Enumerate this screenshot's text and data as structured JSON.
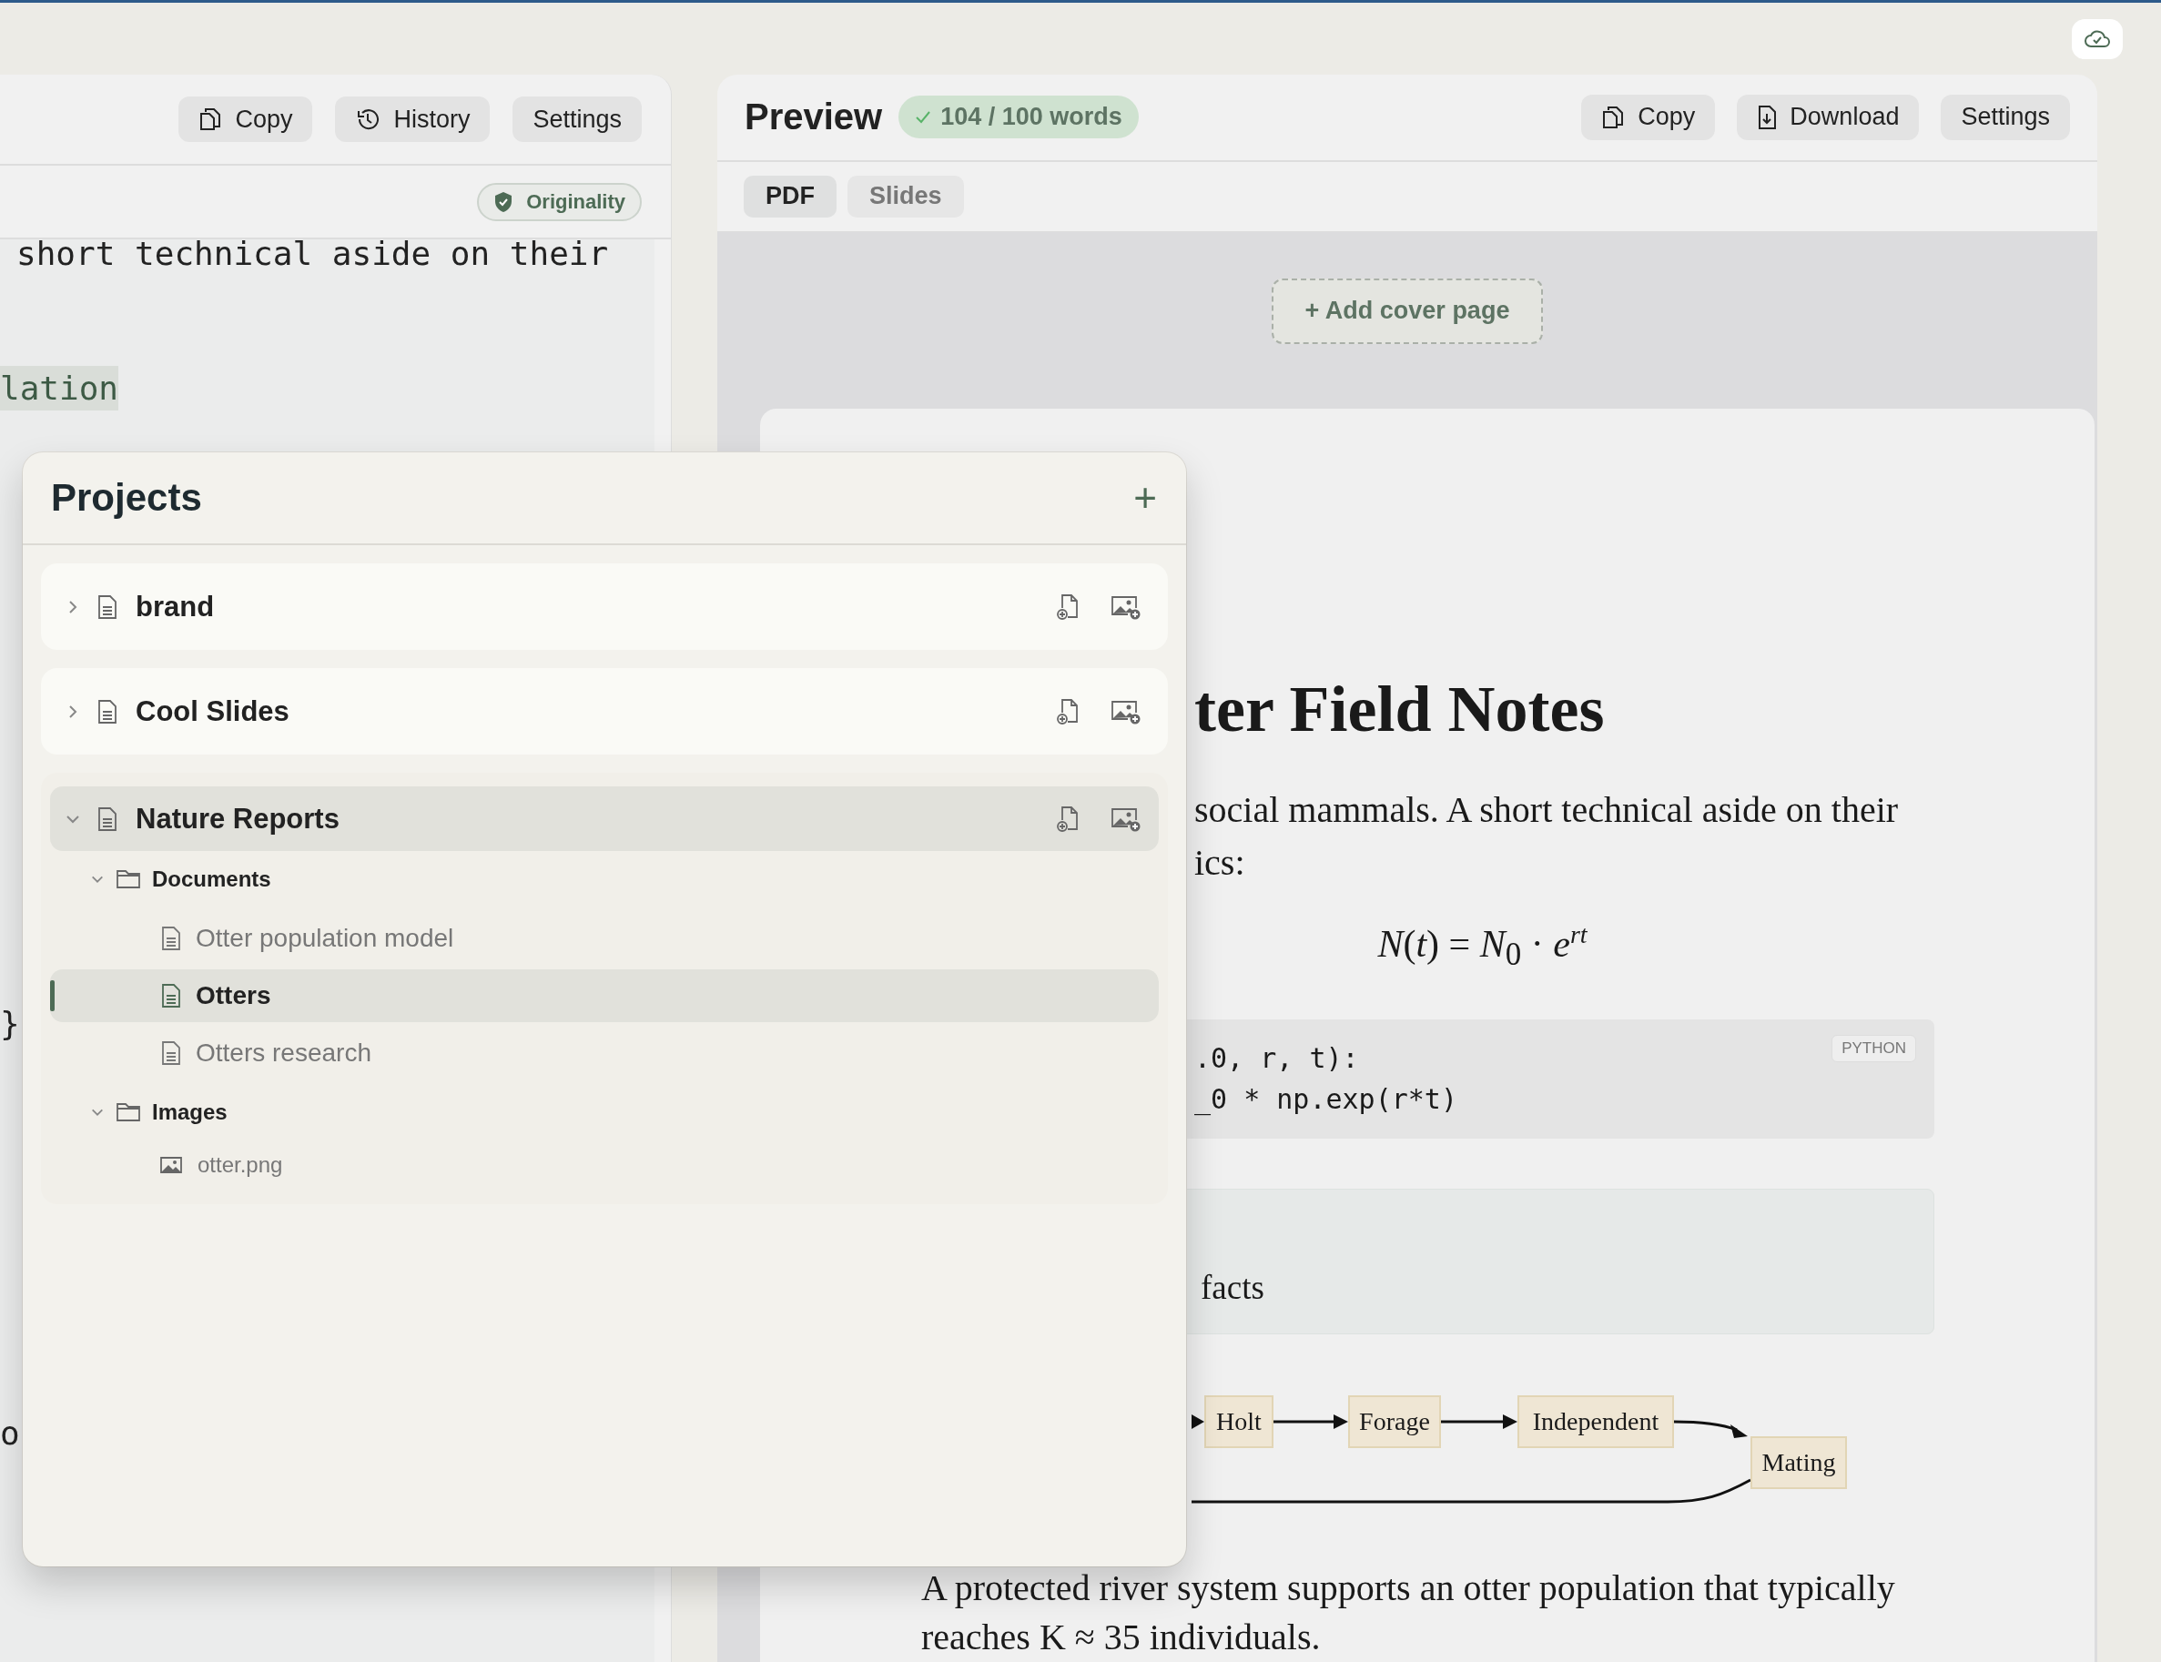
{
  "editor": {
    "toolbar": [
      {
        "label": "Copy",
        "kind": "copy"
      },
      {
        "label": "History",
        "kind": "history"
      },
      {
        "label": "Settings",
        "kind": "plain"
      }
    ],
    "badge": "Originality",
    "lines": [
      {
        "text": "short technical aside on their",
        "kind": "plain"
      },
      {
        "text": "lation",
        "kind": "highlight"
      },
      {
        "text": "}",
        "kind": "plain"
      },
      {
        "text": "o",
        "kind": "plain"
      }
    ]
  },
  "preview": {
    "title": "Preview",
    "word_count": "104 / 100 words",
    "toolbar": [
      {
        "label": "Copy",
        "kind": "copy"
      },
      {
        "label": "Download",
        "kind": "download"
      },
      {
        "label": "Settings",
        "kind": "plain"
      }
    ],
    "tabs": [
      {
        "label": "PDF",
        "selected": true
      },
      {
        "label": "Slides",
        "selected": false
      }
    ],
    "add_cover": "+ Add cover page",
    "document": {
      "title": "ter Field Notes",
      "body": [
        "social mammals. A short technical aside on their",
        "ics:"
      ],
      "formula": "*N*(*t*) = *N*$_{0}$ · *e*$^{rt}$",
      "code": {
        "language": "PYTHON",
        "lines": [
          ".0, r, t):",
          "_0 * np.exp(r*t)"
        ]
      },
      "callout": "facts",
      "diagram": {
        "nodes": [
          {
            "label": "Holt"
          },
          {
            "label": "Forage"
          },
          {
            "label": "Independent"
          },
          {
            "label": "Mating"
          }
        ]
      },
      "paragraph": "A protected river system supports an otter population that typically reaches K ≈ 35 individuals."
    }
  },
  "projects_panel": {
    "title": "Projects",
    "add": "+",
    "projects": [
      {
        "name": "brand",
        "expanded": false,
        "selected": false
      },
      {
        "name": "Cool Slides",
        "expanded": false,
        "selected": false
      },
      {
        "name": "Nature Reports",
        "expanded": true,
        "selected": true,
        "children": [
          {
            "name": "Documents",
            "kind": "folder",
            "expanded": true,
            "children": [
              {
                "name": "Otter population model",
                "kind": "document",
                "selected": false
              },
              {
                "name": "Otters",
                "kind": "document",
                "selected": true
              },
              {
                "name": "Otters research",
                "kind": "document",
                "selected": false
              }
            ]
          },
          {
            "name": "Images",
            "kind": "folder",
            "expanded": true,
            "children": [
              {
                "name": "otter.png",
                "kind": "image",
                "selected": false
              }
            ]
          }
        ]
      }
    ]
  }
}
